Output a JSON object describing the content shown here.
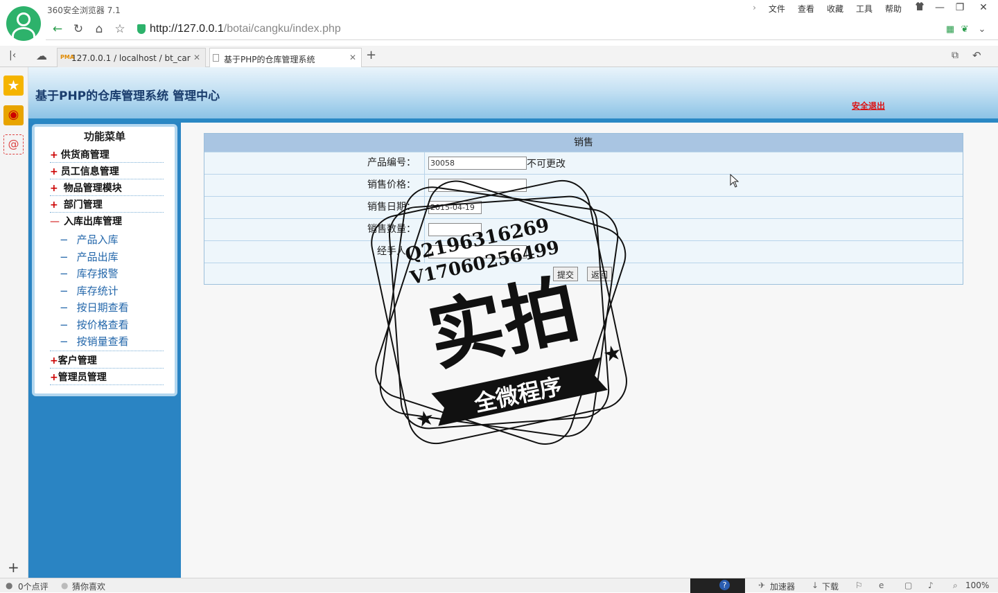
{
  "browser": {
    "app_title": "360安全浏览器 7.1",
    "menu": [
      "文件",
      "查看",
      "收藏",
      "工具",
      "帮助"
    ],
    "url_host": "http://127.0.0.1",
    "url_path": "/botai/cangku/index.php",
    "tabs": [
      {
        "label": "127.0.0.1 / localhost / bt_car",
        "active": false
      },
      {
        "label": "基于PHP的仓库管理系统",
        "active": true
      }
    ],
    "new_tab": "+",
    "status_left_1": "0个点评",
    "status_left_2": "猜你喜欢",
    "status_accelerator": "加速器",
    "status_download": "下载",
    "status_zoom": "100%"
  },
  "page": {
    "system_title": "基于PHP的仓库管理系统 管理中心",
    "logout": "安全退出",
    "menu_title": "功能菜单",
    "menu_items": [
      {
        "sign": "+",
        "label": "供货商管理"
      },
      {
        "sign": "+",
        "label": "员工信息管理"
      },
      {
        "sign": "+",
        "label": "物品管理模块"
      },
      {
        "sign": "+",
        "label": "部门管理"
      },
      {
        "sign": "—",
        "label": "入库出库管理"
      }
    ],
    "sub_items": [
      "产品入库",
      "产品出库",
      "库存报警",
      "库存统计",
      "按日期查看",
      "按价格查看",
      "按销量查看"
    ],
    "menu_items_after": [
      {
        "sign": "+",
        "label": "客户管理"
      },
      {
        "sign": "+",
        "label": "管理员管理"
      }
    ],
    "form": {
      "title": "销售",
      "fields": [
        {
          "label": "产品编号：",
          "value": "30058",
          "note": "不可更改"
        },
        {
          "label": "销售价格：",
          "value": ""
        },
        {
          "label": "销售日期：",
          "value": "2015-04-19"
        },
        {
          "label": "销售数量：",
          "value": ""
        },
        {
          "label": "经手人：",
          "value": ""
        }
      ],
      "submit_label": "提交",
      "back_label": "返回"
    }
  },
  "watermark": {
    "line1": "Q2196316269",
    "line2": "V17060256499",
    "main": "实拍",
    "banner": "全微程序"
  }
}
